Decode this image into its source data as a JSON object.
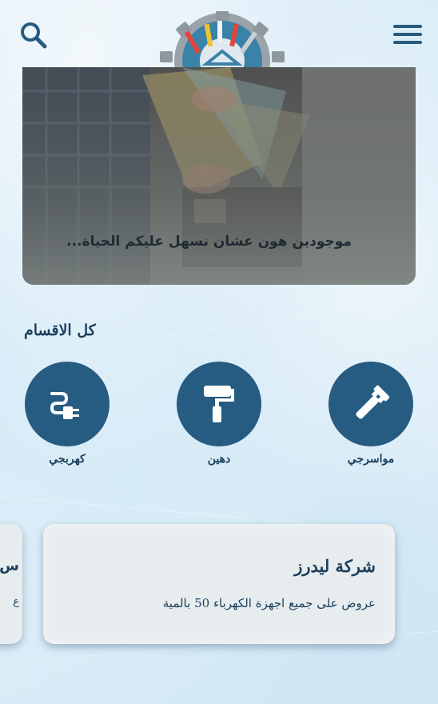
{
  "header": {
    "search_icon": "search-icon",
    "menu_icon": "hamburger-menu-icon",
    "logo": "tools-gear-logo"
  },
  "hero": {
    "caption": "موجودين هون عشان نسهل عليكم الحياة..."
  },
  "categories": {
    "title": "كل الاقسام",
    "items": [
      {
        "label": "مواسرجي",
        "icon": "pipe-wrench-icon"
      },
      {
        "label": "دهين",
        "icon": "paint-roller-icon"
      },
      {
        "label": "كهربجي",
        "icon": "electric-plug-icon"
      }
    ],
    "circle_color": "#265b82"
  },
  "offers": {
    "cards": [
      {
        "title": "شركة ليدرز",
        "description": "عروض على جميع اجهزة الكهرباء 50 بالمية"
      }
    ],
    "peek": {
      "title": "س",
      "description": "ع"
    }
  },
  "colors": {
    "primary": "#265b82",
    "text": "#1b3f5c",
    "card_bg": "#e7ecef"
  }
}
